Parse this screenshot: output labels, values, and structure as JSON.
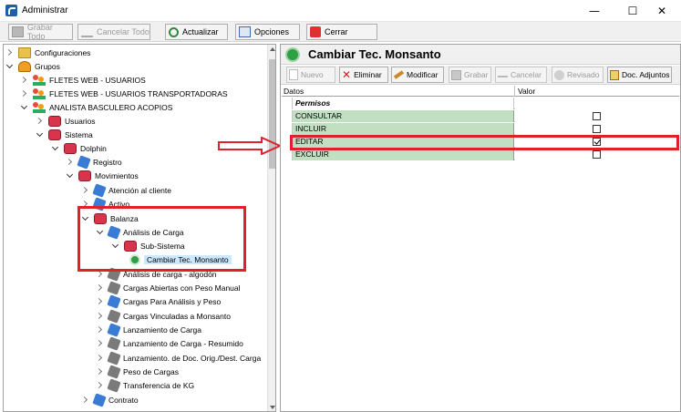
{
  "window": {
    "title": "Administrar",
    "minimize": "—",
    "maximize": "☐",
    "close": "✕"
  },
  "toolbar": {
    "save_all": "Grabar Todo",
    "cancel_all": "Cancelar Todo",
    "refresh": "Actualizar",
    "options": "Opciones",
    "close": "Cerrar"
  },
  "tree": {
    "items": [
      {
        "label": "Configuraciones"
      },
      {
        "label": "Grupos"
      },
      {
        "label": "FLETES WEB - USUARIOS"
      },
      {
        "label": "FLETES WEB - USUARIOS TRANSPORTADORAS"
      },
      {
        "label": "ANALISTA BASCULERO ACOPIOS"
      },
      {
        "label": "Usuarios"
      },
      {
        "label": "Sistema"
      },
      {
        "label": "Dolphin"
      },
      {
        "label": "Registro"
      },
      {
        "label": "Movimientos"
      },
      {
        "label": "Atención al cliente"
      },
      {
        "label": "Activo"
      },
      {
        "label": "Balanza"
      },
      {
        "label": "Análisis de Carga"
      },
      {
        "label": "Sub-Sistema"
      },
      {
        "label": "Cambiar Tec. Monsanto"
      },
      {
        "label": "Análisis de carga - algodón"
      },
      {
        "label": "Cargas Abiertas con Peso Manual"
      },
      {
        "label": "Cargas Para Análisis y Peso"
      },
      {
        "label": "Cargas Vinculadas a Monsanto"
      },
      {
        "label": "Lanzamiento de Carga"
      },
      {
        "label": "Lanzamiento de Carga - Resumido"
      },
      {
        "label": "Lanzamiento. de Doc. Orig./Dest. Carga"
      },
      {
        "label": "Peso de Cargas"
      },
      {
        "label": "Transferencia de KG"
      },
      {
        "label": "Contrato"
      }
    ]
  },
  "detail": {
    "title": "Cambiar Tec. Monsanto",
    "toolbar": {
      "new": "Nuevo",
      "delete": "Eliminar",
      "modify": "Modificar",
      "save": "Grabar",
      "cancel": "Cancelar",
      "reviewed": "Revisado",
      "attachments": "Doc. Adjuntos"
    },
    "grid": {
      "columns": [
        "Datos",
        "Valor"
      ],
      "group_label": "Permisos",
      "rows": [
        {
          "label": "CONSULTAR",
          "checked": false
        },
        {
          "label": "INCLUIR",
          "checked": false
        },
        {
          "label": "EDITAR",
          "checked": true
        },
        {
          "label": "EXCLUIR",
          "checked": false
        }
      ]
    }
  },
  "colors": {
    "highlight_red": "#e0202a",
    "row_green": "#c1e0c1",
    "selection_blue": "#cce8ff"
  }
}
